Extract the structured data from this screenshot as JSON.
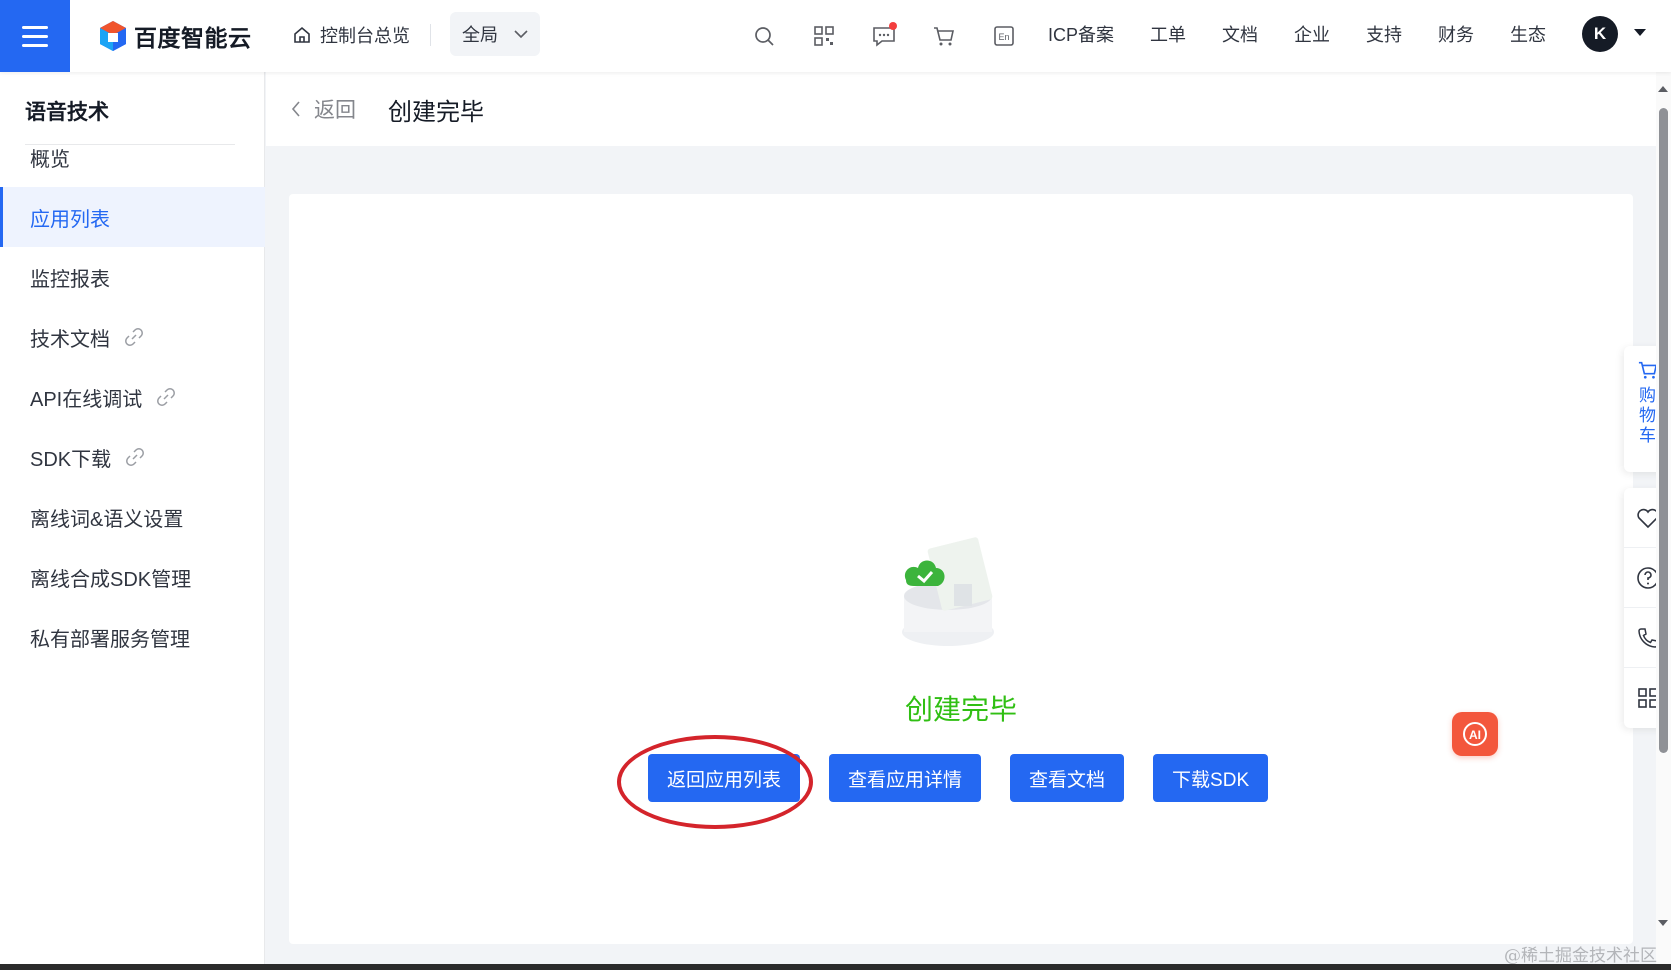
{
  "brand": {
    "name": "百度智能云",
    "accent": "#2468f2"
  },
  "header": {
    "home_label": "控制台总览",
    "scope_label": "全局",
    "icons": [
      "search-icon",
      "qrcode-icon",
      "message-icon",
      "cart-icon",
      "language-icon"
    ],
    "links": [
      "ICP备案",
      "工单",
      "文档",
      "企业",
      "支持",
      "财务",
      "生态"
    ],
    "avatar_initial": "K"
  },
  "sidebar": {
    "title": "语音技术",
    "items": [
      {
        "label": "概览",
        "active": false,
        "external": false
      },
      {
        "label": "应用列表",
        "active": true,
        "external": false
      },
      {
        "label": "监控报表",
        "active": false,
        "external": false
      },
      {
        "label": "技术文档",
        "active": false,
        "external": true
      },
      {
        "label": "API在线调试",
        "active": false,
        "external": true
      },
      {
        "label": "SDK下载",
        "active": false,
        "external": true
      },
      {
        "label": "离线词&语义设置",
        "active": false,
        "external": false
      },
      {
        "label": "离线合成SDK管理",
        "active": false,
        "external": false
      },
      {
        "label": "私有部署服务管理",
        "active": false,
        "external": false
      }
    ]
  },
  "content": {
    "back_label": "返回",
    "page_title": "创建完毕",
    "result_text": "创建完毕",
    "result_color": "#30bf13",
    "buttons": {
      "back_to_list": "返回应用列表",
      "view_details": "查看应用详情",
      "view_docs": "查看文档",
      "download_sdk": "下载SDK"
    }
  },
  "float_panel": {
    "cart_label": "购物车",
    "tools": [
      "heart-icon",
      "help-icon",
      "phone-icon",
      "grid-icon"
    ]
  },
  "watermark": "@稀土掘金技术社区"
}
